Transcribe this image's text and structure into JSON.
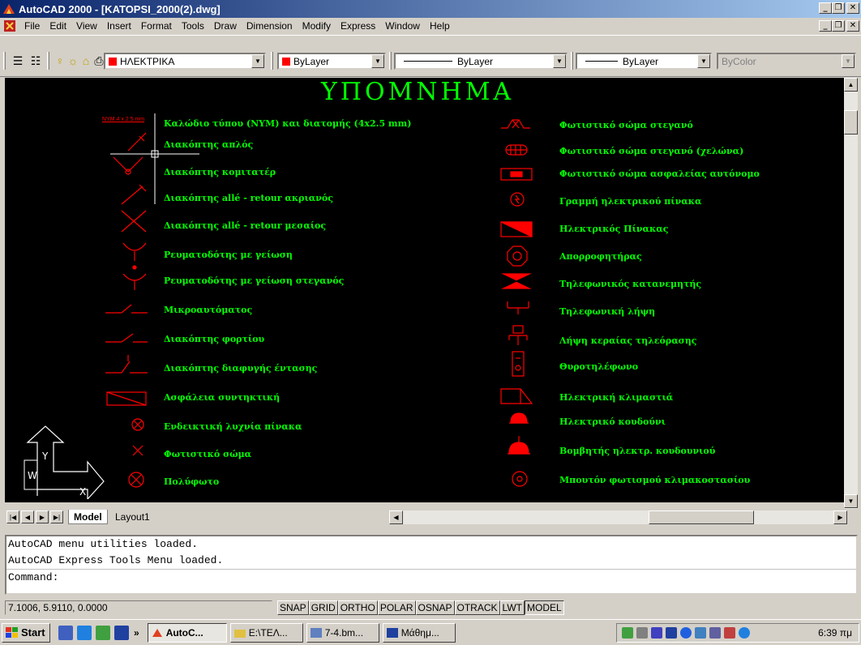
{
  "window": {
    "title": "AutoCAD 2000 - [KATOPSI_2000(2).dwg]"
  },
  "menu": [
    "File",
    "Edit",
    "View",
    "Insert",
    "Format",
    "Tools",
    "Draw",
    "Dimension",
    "Modify",
    "Express",
    "Window",
    "Help"
  ],
  "toolbar": {
    "layer": "ΗΛΕΚΤΡΙΚΑ",
    "color": "ByLayer",
    "linetype": "ByLayer",
    "lineweight": "ByLayer",
    "plotstyle": "ByColor"
  },
  "drawing": {
    "title": "ΥΠΟΜΝΗΜΑ",
    "cable_tag": "NYM 4 x 2.5 mm",
    "left_legend": [
      "Καλώδιο τύπου (NYM) και διατομής (4x2.5 mm)",
      "Διακόπτης απλός",
      "Διακόπτης κομιτατέρ",
      "Διακόπτης allé - retour ακριανός",
      "Διακόπτης allé - retour μεσαίος",
      "Ρευματοδότης με γείωση",
      "Ρευματοδότης με γείωση στεγανός",
      "Μικροαυτόματος",
      "Διακόπτης φορτίου",
      "Διακόπτης διαφυγής έντασης",
      "Ασφάλεια συντηκτική",
      "Ενδεικτική λυχνία πίνακα",
      "Φωτιστικό σώμα",
      "Πολύφωτο"
    ],
    "right_legend": [
      "Φωτιστικό σώμα στεγανό",
      "Φωτιστικό σώμα στεγανό (χελώνα)",
      "Φωτιστικό σώμα ασφαλείας αυτόνομο",
      "Γραμμή ηλεκτρικού πίνακα",
      "Ηλεκτρικός Πίνακας",
      "Απορροφητήρας",
      "Τηλεφωνικός κατανεμητής",
      "Τηλεφωνική λήψη",
      "Λήψη κεραίας τηλεόρασης",
      "Θυροτηλέφωνο",
      "Ηλεκτρική κλιμαστιά",
      "Ηλεκτρικό κουδούνι",
      "Βομβητής ηλεκτρ. κουδουνιού",
      "Μπουτόν φωτισμού κλιμακοστασίου"
    ],
    "ucs_y": "Y",
    "ucs_w": "W",
    "ucs_x": "X"
  },
  "tabs": [
    "Model",
    "Layout1"
  ],
  "command": {
    "lines": [
      "AutoCAD menu utilities loaded.",
      "AutoCAD Express Tools Menu loaded."
    ],
    "prompt": "Command:"
  },
  "status": {
    "coords": "7.1006, 5.9110, 0.0000",
    "toggles": [
      "SNAP",
      "GRID",
      "ORTHO",
      "POLAR",
      "OSNAP",
      "OTRACK",
      "LWT",
      "MODEL"
    ]
  },
  "taskbar": {
    "start": "Start",
    "tasks": [
      "AutoC...",
      "E:\\ΤΕΛ...",
      "7-4.bm...",
      "Μάθημ..."
    ],
    "clock": "6:39 πμ"
  },
  "colors": {
    "drawing_bg": "#000000",
    "legend_text": "#00ff00",
    "symbols": "#ff0000"
  }
}
